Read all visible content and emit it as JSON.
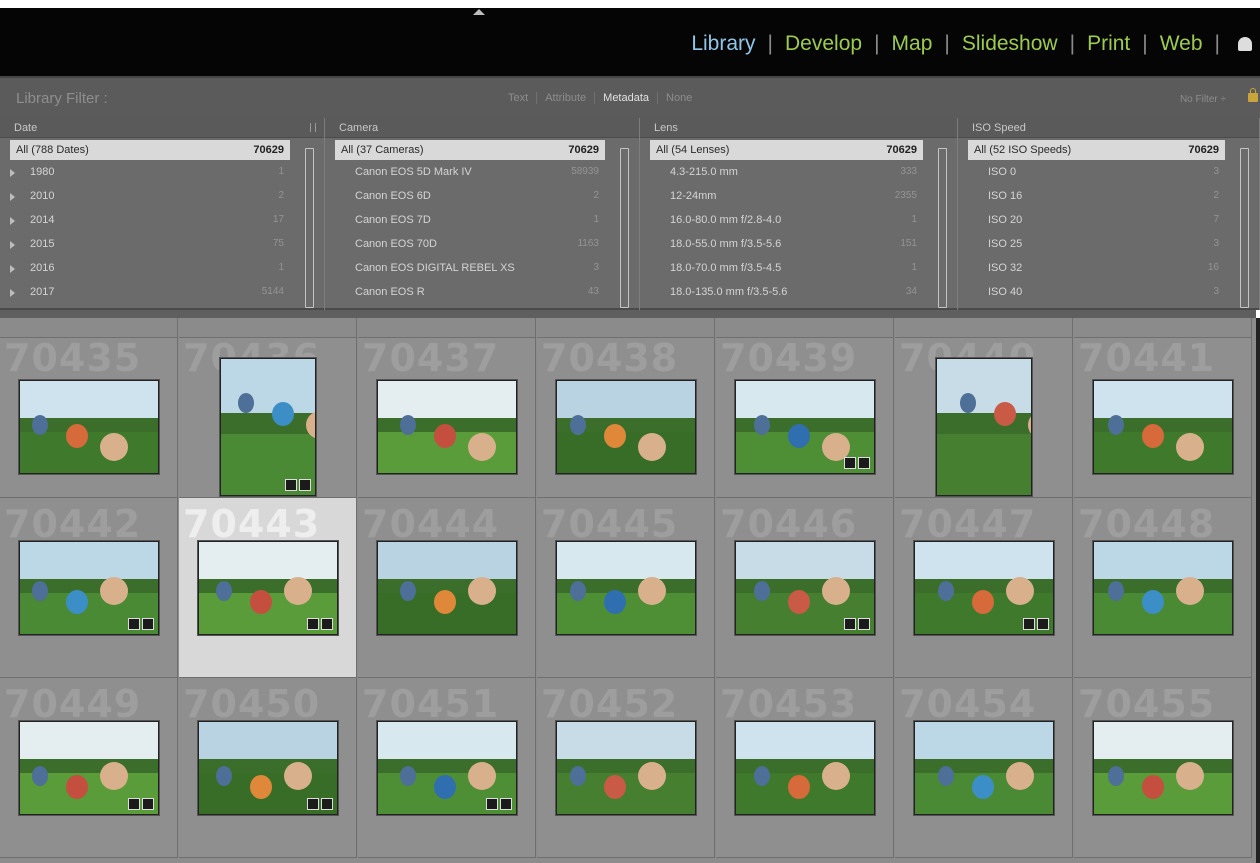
{
  "modules": {
    "items": [
      {
        "label": "Library",
        "active": true
      },
      {
        "label": "Develop",
        "active": false
      },
      {
        "label": "Map",
        "active": false
      },
      {
        "label": "Slideshow",
        "active": false
      },
      {
        "label": "Print",
        "active": false
      },
      {
        "label": "Web",
        "active": false
      }
    ],
    "separator": "|",
    "accent_active": "#8fc6e8",
    "accent_inactive": "#9ccb4e"
  },
  "filter_bar": {
    "title": "Library Filter :",
    "tabs": [
      "Text",
      "Attribute",
      "Metadata",
      "None"
    ],
    "active_tab": "Metadata",
    "preset": "No Filter ÷",
    "lock_icon": "lock-icon"
  },
  "metadata_columns": [
    {
      "header": "Date",
      "all": {
        "label": "All (788 Dates)",
        "count": "70629"
      },
      "rows": [
        {
          "label": "1980",
          "count": "1"
        },
        {
          "label": "2010",
          "count": "2"
        },
        {
          "label": "2014",
          "count": "17"
        },
        {
          "label": "2015",
          "count": "75"
        },
        {
          "label": "2016",
          "count": "1"
        },
        {
          "label": "2017",
          "count": "5144"
        }
      ]
    },
    {
      "header": "Camera",
      "all": {
        "label": "All (37 Cameras)",
        "count": "70629"
      },
      "rows": [
        {
          "label": "Canon EOS 5D Mark IV",
          "count": "58939"
        },
        {
          "label": "Canon EOS 6D",
          "count": "2"
        },
        {
          "label": "Canon EOS 7D",
          "count": "1"
        },
        {
          "label": "Canon EOS 70D",
          "count": "1163"
        },
        {
          "label": "Canon EOS DIGITAL REBEL XS",
          "count": "3"
        },
        {
          "label": "Canon EOS R",
          "count": "43"
        }
      ]
    },
    {
      "header": "Lens",
      "all": {
        "label": "All (54 Lenses)",
        "count": "70629"
      },
      "rows": [
        {
          "label": "4.3-215.0 mm",
          "count": "333"
        },
        {
          "label": "12-24mm",
          "count": "2355"
        },
        {
          "label": "16.0-80.0 mm f/2.8-4.0",
          "count": "1"
        },
        {
          "label": "18.0-55.0 mm f/3.5-5.6",
          "count": "151"
        },
        {
          "label": "18.0-70.0 mm f/3.5-4.5",
          "count": "1"
        },
        {
          "label": "18.0-135.0 mm f/3.5-5.6",
          "count": "34"
        }
      ]
    },
    {
      "header": "ISO Speed",
      "all": {
        "label": "All (52 ISO Speeds)",
        "count": "70629"
      },
      "rows": [
        {
          "label": "ISO 0",
          "count": "3"
        },
        {
          "label": "ISO 16",
          "count": "2"
        },
        {
          "label": "ISO 20",
          "count": "7"
        },
        {
          "label": "ISO 25",
          "count": "3"
        },
        {
          "label": "ISO 32",
          "count": "16"
        },
        {
          "label": "ISO 40",
          "count": "3"
        }
      ]
    }
  ],
  "grid": {
    "rows": [
      [
        "70435",
        "70436",
        "70437",
        "70438",
        "70439",
        "70440",
        "70441"
      ],
      [
        "70442",
        "70443",
        "70444",
        "70445",
        "70446",
        "70447",
        "70448"
      ],
      [
        "70449",
        "70450",
        "70451",
        "70452",
        "70453",
        "70454",
        "70455"
      ]
    ],
    "selected": "70443"
  }
}
